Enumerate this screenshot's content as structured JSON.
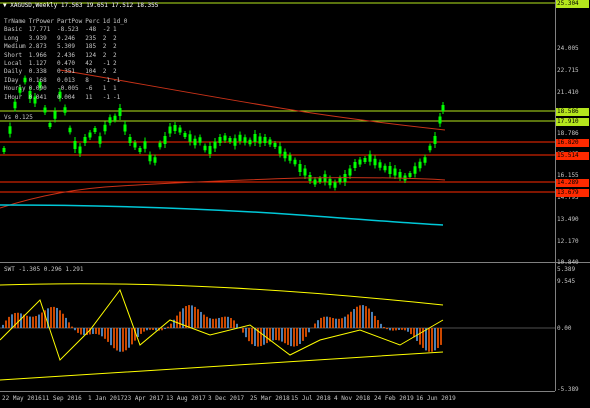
{
  "header": {
    "symbol": "XAGUSD,Weekly",
    "ohlc": "17.563 19.651 17.512 18.355"
  },
  "stats_table": {
    "columns": [
      "TrName",
      "TrPower",
      "PartPow",
      "Perc",
      "1d",
      "1d_0"
    ],
    "rows": [
      [
        "Basic",
        "17.771",
        "-8.523",
        "-48",
        "-2",
        "1"
      ],
      [
        "Long",
        "3.939",
        "9.246",
        "235",
        "2",
        "2"
      ],
      [
        "Medium",
        "2.873",
        "5.309",
        "185",
        "2",
        "2"
      ],
      [
        "Short",
        "1.966",
        "2.436",
        "124",
        "2",
        "2"
      ],
      [
        "Local",
        "1.127",
        "0.470",
        "42",
        "-1",
        "2"
      ],
      [
        "Daily",
        "0.338",
        "0.351",
        "104",
        "2",
        "2"
      ],
      [
        "IDay",
        "0.168",
        "0.013",
        "8",
        "-1",
        "-1"
      ],
      [
        "Hourly",
        "0.090",
        "-0.005",
        "-6",
        "1",
        "1"
      ],
      [
        "IHour",
        "0.041",
        "0.004",
        "11",
        "-1",
        "-1"
      ]
    ]
  },
  "vs_label": "Vs 0.125",
  "subwindow": {
    "label": "SWT -1.305 0.296 1.291"
  },
  "price_axis": {
    "labels": [
      "25.304",
      "24.005",
      "22.715",
      "21.410",
      "20.080",
      "18.786",
      "17.465",
      "16.155",
      "14.795",
      "13.490",
      "12.170",
      "10.840",
      "9.545"
    ],
    "tags": [
      {
        "text": "18.586",
        "color": "#b5e61d"
      },
      {
        "text": "17.910",
        "color": "#b5e61d"
      },
      {
        "text": "16.820",
        "color": "#ff2a00"
      },
      {
        "text": "15.514",
        "color": "#ff2a00"
      },
      {
        "text": "14.289",
        "color": "#ff2a00"
      },
      {
        "text": "13.679",
        "color": "#ff2a00"
      }
    ],
    "top_tag": "25.304"
  },
  "sub_axis": {
    "labels": [
      "5.389",
      "0.00",
      "-5.389"
    ]
  },
  "time_axis": {
    "labels": [
      "22 May 2016",
      "11 Sep 2016",
      "1 Jan 2017",
      "23 Apr 2017",
      "13 Aug 2017",
      "3 Dec 2017",
      "25 Mar 2018",
      "15 Jul 2018",
      "4 Nov 2018",
      "24 Feb 2019",
      "16 Jun 2019"
    ]
  },
  "colors": {
    "bull_candle": "#00ff00",
    "level_green": "#b5e61d",
    "level_red": "#ff2a00",
    "ma_cyan": "#00c8d8",
    "ma_red": "#c83218",
    "osc_yellow": "#ffff00",
    "osc_blue": "#5aa0e6",
    "osc_orange": "#ff5a00"
  }
}
